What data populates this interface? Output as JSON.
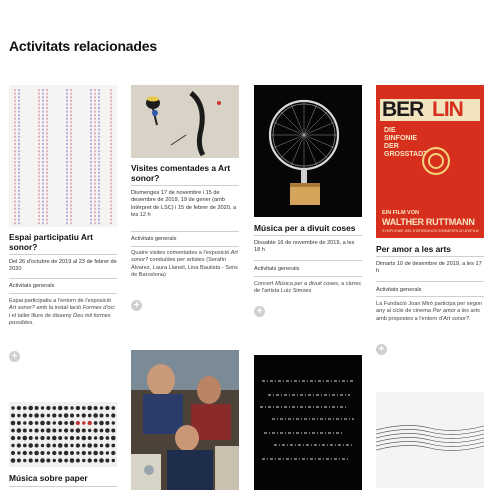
{
  "section": {
    "title": "Activitats relacionades"
  },
  "cards": [
    {
      "title": "Espai participatiu Art sonor?",
      "date": "Del 26 d'octubre de 2019 al 23 de febrer de 2020",
      "category": "Activitats generals",
      "desc": "Espai participatiu a l'entorn de l'exposició <i>Art sonor?</i> amb la instal·lació <i>Formes d'oci</i> i el taller lliure de disseny <i>Deu mil formes possibles</i>."
    },
    {
      "title": "Visites comentades a Art sonor?",
      "date": "Diumenges 17 de novembre i 15 de desembre de 2019, 19 de gener (amb intèrpret de LSC) i 15 de febrer de 2020, a les 12 h",
      "category": "Activitats generals",
      "desc": "Quatre visites comentades a l'exposició <i>Art sonor?</i> conduïdes per artistes (Serafín Álvarez, Laura Llaneli, Lina Bautista - Sons de Barcelona)"
    },
    {
      "title": "Música per a divuit coses",
      "date": "Dissabte 16 de novembre de 2019, a les 18 h",
      "category": "Activitats generals",
      "desc": "Concert <i>Música per a divuit coses</i>, a càrrec de l'artista Luiz Simoes"
    },
    {
      "title": "Per amor a les arts",
      "date": "Dimarts 10 de desembre de 2019, a les 17 h",
      "category": "Activitats generals",
      "desc": "La Fundació Joan Miró participa per segon any al cicle de cinema <i>Per amor a les arts</i> amb propostes a l'entorn d'<i>Art sonor?</i>."
    },
    {
      "title": "Música sobre paper"
    }
  ],
  "poster": {
    "word_ber": "BER",
    "word_lin": "LIN",
    "subtitle_lines": [
      "DIE",
      "SINFONIE",
      "DER",
      "GROSSTADT"
    ],
    "film_line": "EIN FILM VON",
    "director": "WALTHER RUTTMANN",
    "bottom_line": "SYMPHONIE WELTHEREBUNGS  SOMMERFILM UFAFILM"
  }
}
